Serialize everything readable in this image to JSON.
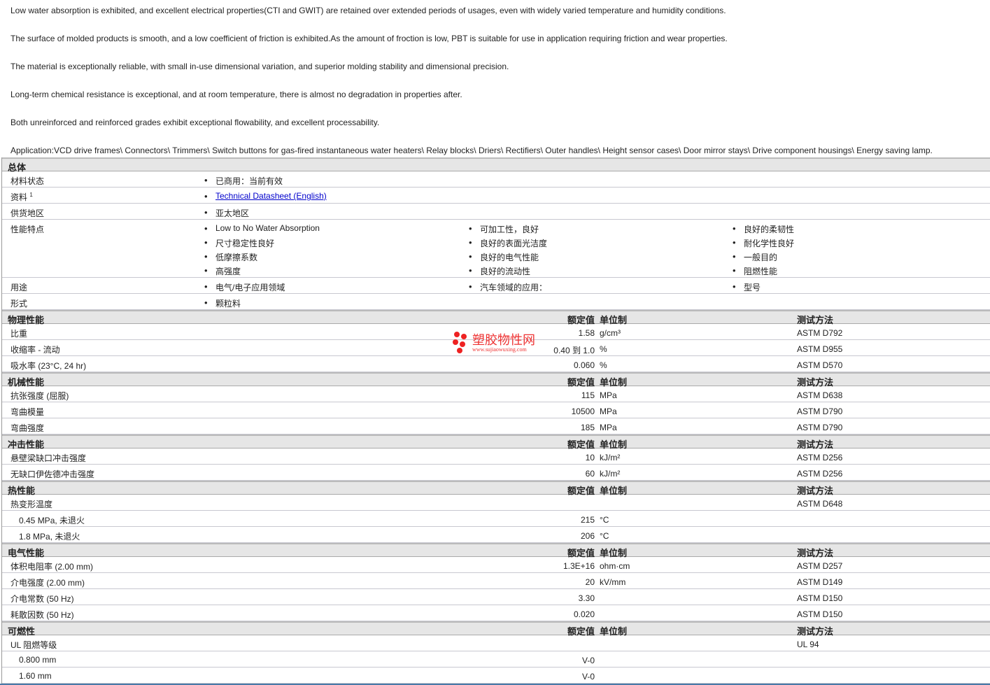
{
  "paragraphs": [
    "Low water absorption is exhibited, and excellent electrical properties(CTI and GWIT) are retained over extended periods of usages, even with widely varied temperature and humidity conditions.",
    "The surface of molded products is smooth, and a low coefficient of friction is exhibited.As the amount of froction is low, PBT is suitable for use in application requiring friction and wear properties.",
    "The material is exceptionally reliable, with small in-use dimensional variation, and superior molding stability and dimensional precision.",
    "Long-term chemical resistance is exceptional, and at room temperature, there is almost no degradation in properties after.",
    "Both unreinforced and reinforced grades exhibit exceptional flowability, and excellent processability.",
    "Application:VCD drive frames\\ Connectors\\ Trimmers\\ Switch buttons for gas-fired instantaneous water heaters\\ Relay blocks\\ Driers\\ Rectifiers\\ Outer handles\\ Height sensor cases\\ Door mirror stays\\ Drive component housings\\ Energy saving lamp."
  ],
  "general": {
    "title": "总体",
    "status_label": "材料状态",
    "status": "已商用：当前有效",
    "docs_label": "资料",
    "docs_sup": "1",
    "docs_link": "Technical Datasheet (English)",
    "region_label": "供货地区",
    "region": "亚太地区",
    "features_label": "性能特点",
    "features": [
      [
        "Low to No Water Absorption",
        "尺寸稳定性良好",
        "低摩擦系数",
        "高强度"
      ],
      [
        "可加工性，良好",
        "良好的表面光洁度",
        "良好的电气性能",
        "良好的流动性"
      ],
      [
        "良好的柔韧性",
        "耐化学性良好",
        "一般目的",
        "阻燃性能"
      ]
    ],
    "uses_label": "用途",
    "uses": [
      "电气/电子应用领域",
      "汽车领域的应用：",
      "型号"
    ],
    "form_label": "形式",
    "form": "颗粒料"
  },
  "headers": {
    "value": "额定值",
    "unit": "单位制",
    "method": "测试方法"
  },
  "watermark": {
    "name": "塑胶物性网",
    "url": "www.sujiaowuxing.com"
  },
  "sections": [
    {
      "title": "物理性能",
      "rows": [
        {
          "label": "比重",
          "value": "1.58",
          "unit": "g/cm³",
          "method": "ASTM D792"
        },
        {
          "label": "收缩率 - 流动",
          "value": "0.40 到  1.0",
          "unit": "%",
          "method": "ASTM D955"
        },
        {
          "label": "吸水率 (23°C, 24 hr)",
          "value": "0.060",
          "unit": "%",
          "method": "ASTM D570"
        }
      ]
    },
    {
      "title": "机械性能",
      "rows": [
        {
          "label": "抗张强度 (屈服)",
          "value": "115",
          "unit": "MPa",
          "method": "ASTM D638"
        },
        {
          "label": "弯曲模量",
          "value": "10500",
          "unit": "MPa",
          "method": "ASTM D790"
        },
        {
          "label": "弯曲强度",
          "value": "185",
          "unit": "MPa",
          "method": "ASTM D790"
        }
      ]
    },
    {
      "title": "冲击性能",
      "rows": [
        {
          "label": "悬壁梁缺口冲击强度",
          "value": "10",
          "unit": "kJ/m²",
          "method": "ASTM D256"
        },
        {
          "label": "无缺口伊佐德冲击强度",
          "value": "60",
          "unit": "kJ/m²",
          "method": "ASTM D256"
        }
      ]
    },
    {
      "title": "热性能",
      "rows": [
        {
          "label": "热变形温度",
          "value": "",
          "unit": "",
          "method": "ASTM D648"
        },
        {
          "label": "0.45 MPa, 未退火",
          "indent": true,
          "value": "215",
          "unit": "°C",
          "method": ""
        },
        {
          "label": "1.8 MPa, 未退火",
          "indent": true,
          "value": "206",
          "unit": "°C",
          "method": ""
        }
      ]
    },
    {
      "title": "电气性能",
      "rows": [
        {
          "label": "体积电阻率 (2.00 mm)",
          "value": "1.3E+16",
          "unit": "ohm·cm",
          "method": "ASTM D257"
        },
        {
          "label": "介电强度 (2.00 mm)",
          "value": "20",
          "unit": "kV/mm",
          "method": "ASTM D149"
        },
        {
          "label": "介电常数 (50 Hz)",
          "value": "3.30",
          "unit": "",
          "method": "ASTM D150"
        },
        {
          "label": "耗散因数 (50 Hz)",
          "value": "0.020",
          "unit": "",
          "method": "ASTM D150"
        }
      ]
    },
    {
      "title": "可燃性",
      "rows": [
        {
          "label": "UL 阻燃等级",
          "value": "",
          "unit": "",
          "method": "UL 94"
        },
        {
          "label": "0.800 mm",
          "indent": true,
          "value": "V-0",
          "unit": "",
          "method": ""
        },
        {
          "label": "1.60 mm",
          "indent": true,
          "value": "V-0",
          "unit": "",
          "method": ""
        }
      ]
    }
  ]
}
